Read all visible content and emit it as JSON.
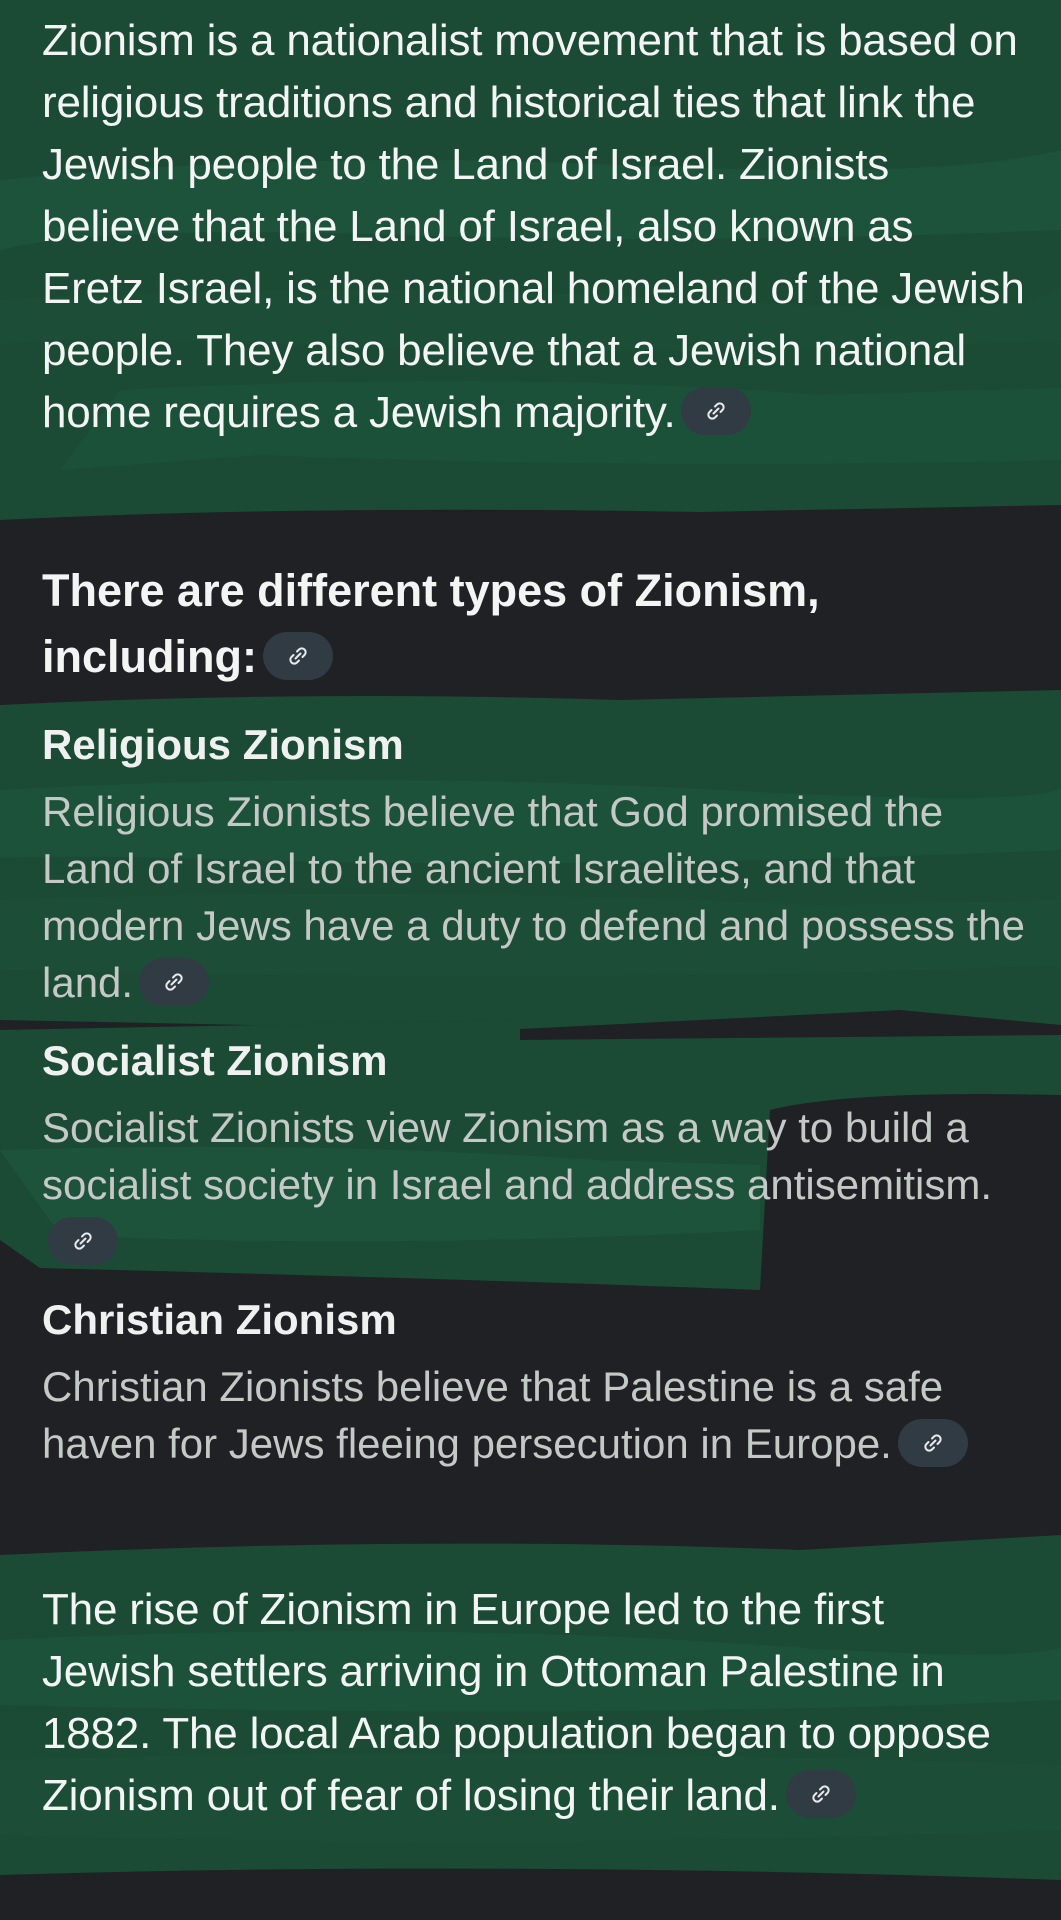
{
  "colors": {
    "background": "#202124",
    "highlight_stroke": "#1b4a35",
    "highlight_stroke_light": "#1f5a3f",
    "chip_background": "#303b44",
    "primary_text": "#f3f5f4",
    "secondary_text": "#c4c9c6"
  },
  "intro": {
    "text": "Zionism is a nationalist movement that is based on religious traditions and historical ties that link the Jewish people to the Land of Israel. Zionists believe that the Land of Israel, also known as Eretz Israel, is the national homeland of the Jewish people. They also believe that a Jewish national home requires a Jewish majority.",
    "link_icon": "link-icon"
  },
  "types": {
    "heading": "There are different types of Zionism, including:",
    "link_icon": "link-icon",
    "items": [
      {
        "title": "Religious Zionism",
        "description": "Religious Zionists believe that God promised the Land of Israel to the ancient Israelites, and that modern Jews have a duty to defend and possess the land.",
        "link_icon": "link-icon"
      },
      {
        "title": "Socialist Zionism",
        "description": "Socialist Zionists view Zionism as a way to build a socialist society in Israel and address antisemitism.",
        "link_icon": "link-icon"
      },
      {
        "title": "Christian Zionism",
        "description": "Christian Zionists believe that Palestine is a safe haven for Jews fleeing persecution in Europe.",
        "link_icon": "link-icon"
      }
    ]
  },
  "closing": {
    "text": "The rise of Zionism in Europe led to the first Jewish settlers arriving in Ottoman Palestine in 1882. The local Arab population began to oppose Zionism out of fear of losing their land.",
    "link_icon": "link-icon"
  }
}
